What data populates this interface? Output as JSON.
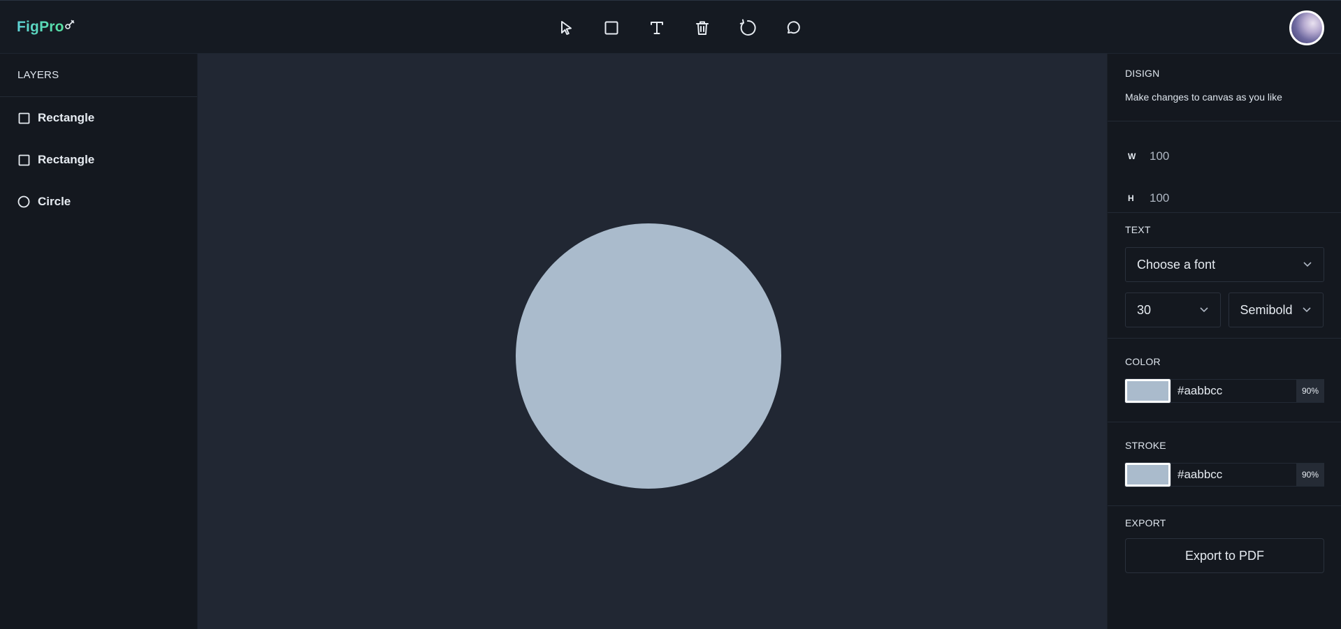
{
  "app": {
    "name": "FigPro"
  },
  "toolbar": {
    "tools": [
      {
        "name": "select",
        "icon": "cursor-icon"
      },
      {
        "name": "rectangle",
        "icon": "rectangle-icon"
      },
      {
        "name": "text",
        "icon": "text-icon"
      },
      {
        "name": "delete",
        "icon": "trash-icon"
      },
      {
        "name": "reset",
        "icon": "rotate-icon"
      },
      {
        "name": "comments",
        "icon": "comment-icon"
      }
    ]
  },
  "layers": {
    "title": "LAYERS",
    "items": [
      {
        "label": "Rectangle",
        "icon": "square-icon"
      },
      {
        "label": "Rectangle",
        "icon": "square-icon"
      },
      {
        "label": "Circle",
        "icon": "circle-icon"
      }
    ]
  },
  "canvas": {
    "shape": {
      "type": "circle",
      "fill": "#aabbcc"
    },
    "background": "#212733"
  },
  "design": {
    "title": "DISIGN",
    "subtitle": "Make changes to canvas as you like",
    "width_label": "W",
    "width_value": "100",
    "height_label": "H",
    "height_value": "100"
  },
  "text": {
    "title": "TEXT",
    "font_placeholder": "Choose a font",
    "font_size": "30",
    "font_weight": "Semibold"
  },
  "color": {
    "title": "COLOR",
    "hex": "#aabbcc",
    "opacity": "90%"
  },
  "stroke": {
    "title": "STROKE",
    "hex": "#aabbcc",
    "opacity": "90%"
  },
  "export": {
    "title": "EXPORT",
    "button_label": "Export to PDF"
  },
  "colors": {
    "accent": "#5fd1d6",
    "shape_fill": "#aabbcc",
    "panel_bg": "#14181f",
    "canvas_bg": "#212733"
  }
}
